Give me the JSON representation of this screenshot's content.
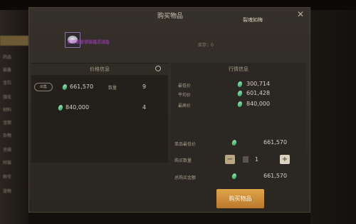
{
  "modal": {
    "title": "购买物品",
    "subtitle": "裂魂如梅",
    "item_name": "玄冥紫金锁链蕴灵战盔",
    "stock_label": "库存：0"
  },
  "price_panel": {
    "header": "价格信息",
    "tag_label": "出售",
    "rows": [
      {
        "price": "661,570",
        "qty_label": "数量",
        "qty": "9"
      },
      {
        "price": "840,000",
        "qty": "4"
      }
    ]
  },
  "market_panel": {
    "header": "行情信息",
    "stats": [
      {
        "label": "最低价",
        "value": "300,714"
      },
      {
        "label": "平均价",
        "value": "601,428"
      },
      {
        "label": "最高价",
        "value": "840,000"
      }
    ],
    "unit_price_label": "单品最低价",
    "unit_price": "661,570",
    "quantity_label": "购买数量",
    "quantity": "1",
    "total_label": "总购买金额",
    "total": "661,570",
    "buy_button": "购买物品"
  },
  "sidebar_left": [
    "",
    "药品",
    "装备",
    "宝石",
    "强化",
    "材料",
    "宝图",
    "杂物",
    "坐骑",
    "时装",
    "称号",
    "宠物"
  ],
  "colors": {
    "accent": "#d49a42",
    "currency": "#3fae6b",
    "item_rarity": "#c040e0"
  },
  "icons": {
    "currency": "jade-gem-icon",
    "refresh": "refresh-icon",
    "close": "close-icon"
  }
}
